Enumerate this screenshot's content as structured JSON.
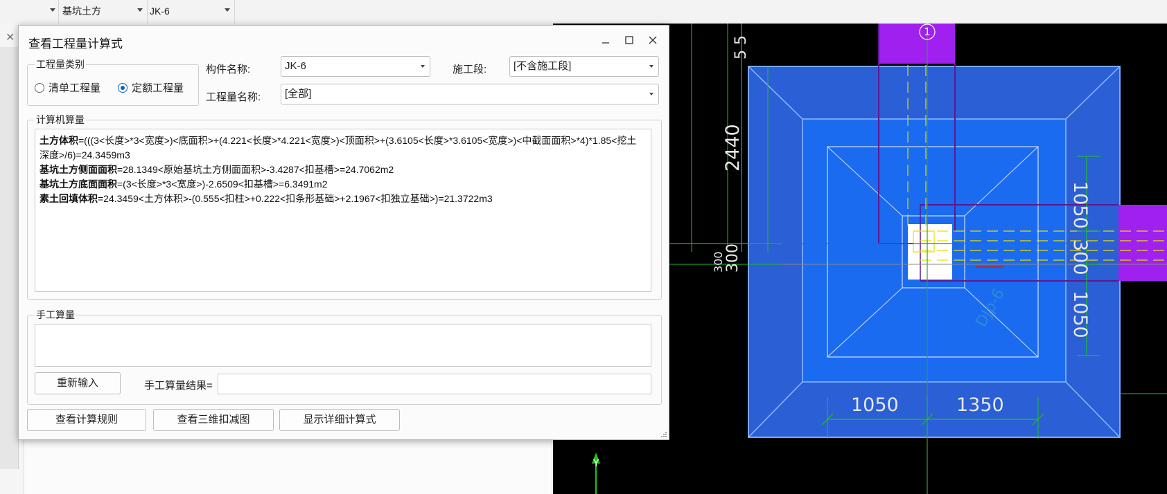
{
  "topbar": {
    "dropdown1": "",
    "dropdown2": "基坑土方",
    "dropdown3": "JK-6"
  },
  "dialog": {
    "title": "查看工程量计算式",
    "window_controls": [
      "minimize-icon",
      "maximize-icon",
      "close-icon"
    ],
    "quantity_type": {
      "label": "工程量类别",
      "options": [
        "清单工程量",
        "定额工程量"
      ],
      "selected": "定额工程量"
    },
    "component_name": {
      "label": "构件名称:",
      "value": "JK-6"
    },
    "construction_section": {
      "label": "施工段:",
      "value": "[不含施工段]"
    },
    "quantity_name": {
      "label": "工程量名称:",
      "value": "[全部]"
    },
    "computer_calc": {
      "label": "计算机算量",
      "lines": [
        {
          "name": "土方体积",
          "formula": "=(((3<长度>*3<宽度>)<底面积>+(4.221<长度>*4.221<宽度>)<顶面积>+(3.6105<长度>*3.6105<宽度>)<中截面面积>*4)*1.85<挖土深度>/6)=24.3459m3"
        },
        {
          "name": "基坑土方侧面面积",
          "formula": "=28.1349<原始基坑土方侧面面积>-3.4287<扣基槽>=24.7062m2"
        },
        {
          "name": "基坑土方底面面积",
          "formula": "=(3<长度>*3<宽度>)-2.6509<扣基槽>=6.3491m2"
        },
        {
          "name": "素土回填体积",
          "formula": "=24.3459<土方体积>-(0.555<扣柱>+0.222<扣条形基础>+2.1967<扣独立基础>)=21.3722m3"
        }
      ]
    },
    "manual_calc": {
      "label": "手工算量",
      "reenter_button": "重新输入",
      "result_label": "手工算量结果=",
      "result_value": ""
    },
    "buttons": {
      "view_rules": "查看计算规则",
      "view_3d": "查看三维扣减图",
      "show_detail": "显示详细计算式"
    }
  },
  "cad": {
    "dimensions": {
      "left_vertical": "2440",
      "right_top": "1050",
      "right_middle": "300",
      "right_bottom": "1050",
      "bottom_left": "1050",
      "bottom_right": "1350",
      "left_small_a": "300",
      "left_small_b": "300",
      "top_partial": "5 5"
    },
    "axis_marker": "1",
    "faint_label": "DJp-6",
    "y_axis_label": "Y",
    "colors": {
      "background": "#000000",
      "pit_outer": "#2b5fd6",
      "pit_inner": "#1a6bf0",
      "column_purple": "#a020f0",
      "dimension_green": "#22c022",
      "grid_yellow": "#e6e000"
    }
  }
}
